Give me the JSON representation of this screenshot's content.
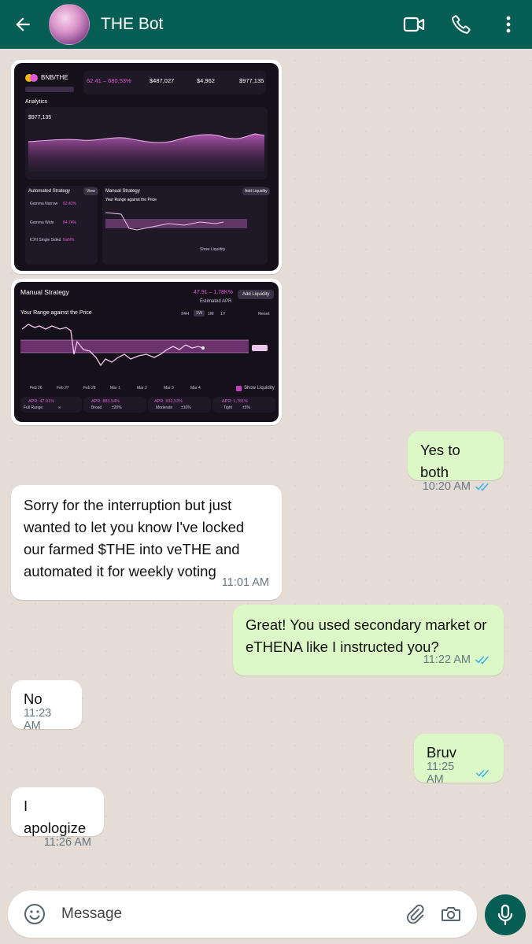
{
  "header": {
    "contact_name": "THE Bot",
    "icons": [
      "back-arrow-icon",
      "video-call-icon",
      "phone-icon",
      "more-vert-icon"
    ]
  },
  "shot1": {
    "pair": "BNB/THE",
    "apr_range": "62.41 – 680.53%",
    "tvl": "$487,027",
    "volume": "$4,962",
    "total": "$977,135",
    "analytics_label": "Analytics",
    "analytics_value": "$977,135",
    "automated_label": "Automated Strategy",
    "view_label": "View",
    "strategies": [
      {
        "name": "Gamma Narrow",
        "tvl": "TVL $90,137",
        "apr": "62.41%"
      },
      {
        "name": "Gamma Wide",
        "tvl": "TVL $32,046",
        "apr": "84.74%"
      },
      {
        "name": "ICHI Single Sided",
        "tvl": "TVL $427,062",
        "apr": "NaN%"
      }
    ],
    "manual_label": "Manual Strategy",
    "range_label": "Your Range against the Price",
    "add_liq": "Add Liquidity",
    "show_liq": "Show Liquidity"
  },
  "shot2": {
    "title": "Manual Strategy",
    "apr": "47.91 – 1.78K%",
    "estimated": "Estimated APR",
    "add_liq": "Add Liquidity",
    "range_label": "Your Range against the Price",
    "timeframes": [
      "24H",
      "1W",
      "1M",
      "1Y"
    ],
    "reset": "Reset",
    "dates": [
      "Feb 26",
      "Feb 27",
      "Feb 28",
      "Mar 1",
      "Mar 2",
      "Mar 3",
      "Mar 4"
    ],
    "show_liq": "Show Liquidity",
    "cards": [
      {
        "apr": "APR: 47.91%",
        "label": "Full Range",
        "pct": "∞"
      },
      {
        "apr": "APR: 883.54%",
        "label": "Broad",
        "pct": "±20%"
      },
      {
        "apr": "APR: 932.52%",
        "label": "Moderate",
        "pct": "±10%"
      },
      {
        "apr": "APR: 1,781%",
        "label": "Tight",
        "pct": "±5%"
      }
    ]
  },
  "messages": [
    {
      "side": "out",
      "text": "Yes to both",
      "time": "10:20 AM"
    },
    {
      "side": "in",
      "text": "Sorry for the interruption but just wanted to let you know I've locked our farmed $THE into veTHE and automated it for weekly voting",
      "time": "11:01 AM"
    },
    {
      "side": "out",
      "text": "Great! You used secondary market or eTHENA like I instructed you?",
      "time": "11:22 AM"
    },
    {
      "side": "in",
      "text": "No",
      "time": "11:23 AM"
    },
    {
      "side": "out",
      "text": "Bruv",
      "time": "11:25 AM"
    },
    {
      "side": "in",
      "text": "I apologize",
      "time": "11:26 AM"
    }
  ],
  "composer": {
    "placeholder": "Message"
  },
  "colors": {
    "header": "#075e54",
    "outgoing": "#dcf8c6",
    "incoming": "#ffffff",
    "read_ticks": "#34b7f1"
  }
}
